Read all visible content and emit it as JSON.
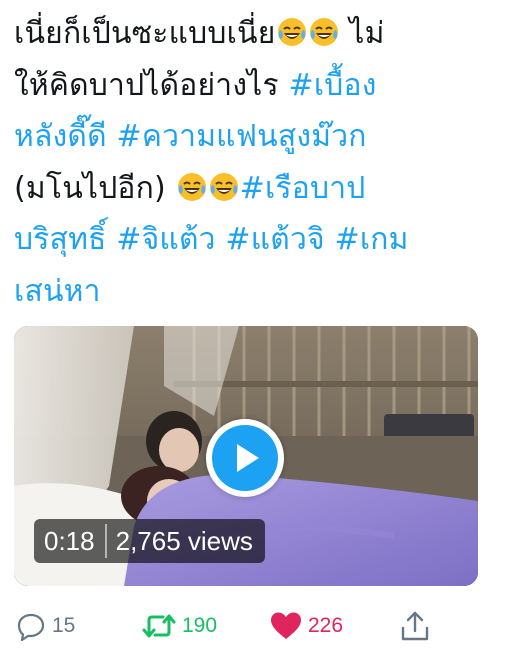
{
  "tweet": {
    "lines": [
      {
        "plain": "เนี่ยก็เป็นซะแบบเนี่ย",
        "tail": " ไม่"
      },
      {
        "plain": "ให้คิดบาปได้อย่างไร ",
        "tag": "#เบื้อง"
      },
      {
        "tag": "หลังดี๊ดี #ความแฟนสูงม๊วก"
      },
      {
        "plain": "(มโนไปอีก) ",
        "tag": "#เรือบาป"
      },
      {
        "tag": "บริสุทธิ์ #จิแต้ว #แต้วจิ #เกม"
      },
      {
        "tag": "เสน่หา"
      }
    ],
    "emoji_name": "face-with-tears-of-joy-icon"
  },
  "video": {
    "duration": "0:18",
    "views": "2,765 views"
  },
  "actions": {
    "replies": "15",
    "retweets": "190",
    "likes": "226"
  },
  "colors": {
    "text": "#14171a",
    "hashtag": "#1da1f2",
    "retweet": "#17bf63",
    "like": "#e0245e",
    "muted": "#657786",
    "play": "#1da1f2"
  }
}
